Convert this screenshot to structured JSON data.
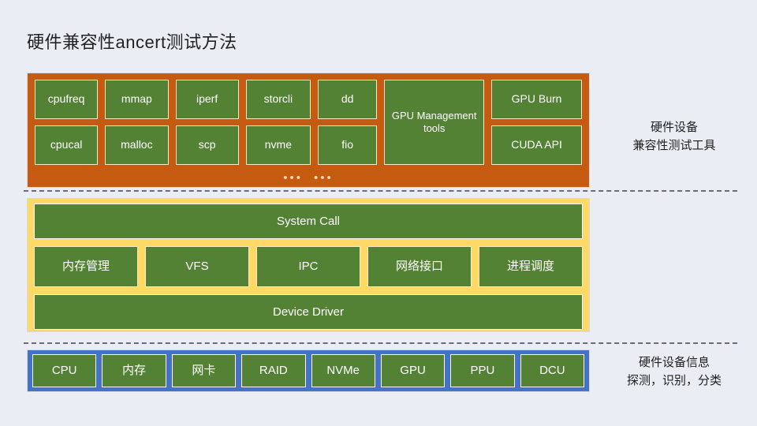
{
  "title": "硬件兼容性ancert测试方法",
  "tools_layer": {
    "columns": [
      {
        "width_class": "w1",
        "items": [
          "cpufreq",
          "cpucal"
        ]
      },
      {
        "width_class": "w2",
        "items": [
          "mmap",
          "malloc"
        ]
      },
      {
        "width_class": "w3",
        "items": [
          "iperf",
          "scp"
        ]
      },
      {
        "width_class": "w4",
        "items": [
          "storcli",
          "nvme"
        ]
      },
      {
        "width_class": "w5",
        "items": [
          "dd",
          "fio"
        ]
      },
      {
        "width_class": "w6",
        "items": [
          "GPU Management tools"
        ]
      },
      {
        "width_class": "w7",
        "items": [
          "GPU Burn",
          "CUDA API"
        ]
      }
    ],
    "ellipsis": [
      "•••",
      "•••"
    ],
    "annotation_line1": "硬件设备",
    "annotation_line2": "兼容性测试工具",
    "background_color": "#C55A11",
    "chip_color": "#548235"
  },
  "kernel_layer": {
    "top_bar": "System Call",
    "middle_items": [
      "内存管理",
      "VFS",
      "IPC",
      "网络接口",
      "进程调度"
    ],
    "bottom_bar": "Device Driver",
    "background_color": "#FFD966",
    "chip_color": "#548235"
  },
  "hardware_layer": {
    "items": [
      "CPU",
      "内存",
      "网卡",
      "RAID",
      "NVMe",
      "GPU",
      "PPU",
      "DCU"
    ],
    "annotation_line1": "硬件设备信息",
    "annotation_line2": "探测，识别，分类",
    "background_color": "#4472C4",
    "chip_color": "#548235"
  },
  "page": {
    "background_color": "#EAEDF4",
    "divider_color": "#6B6B7B"
  }
}
